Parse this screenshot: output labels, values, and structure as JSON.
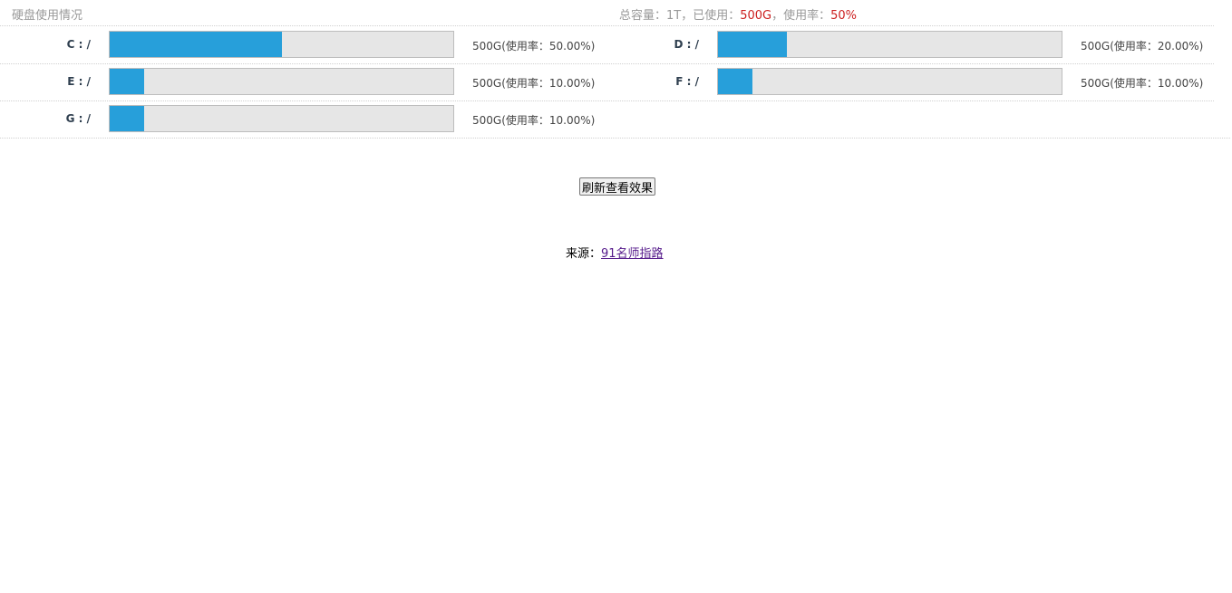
{
  "header": {
    "title": "硬盘使用情况",
    "summary_prefix": "总容量：1T，已使用：",
    "used": "500G",
    "summary_mid": "，使用率：",
    "rate": "50%"
  },
  "disks": [
    {
      "label": "C : /",
      "usage_fraction": 0.5,
      "info": "500G(使用率：50.00%)"
    },
    {
      "label": "D : /",
      "usage_fraction": 0.2,
      "info": "500G(使用率：20.00%)"
    },
    {
      "label": "E : /",
      "usage_fraction": 0.1,
      "info": "500G(使用率：10.00%)"
    },
    {
      "label": "F : /",
      "usage_fraction": 0.1,
      "info": "500G(使用率：10.00%)"
    },
    {
      "label": "G : /",
      "usage_fraction": 0.1,
      "info": "500G(使用率：10.00%)"
    }
  ],
  "refresh_button": "刷新查看效果",
  "source": {
    "prefix": "来源：",
    "link_text": "91名师指路"
  },
  "colors": {
    "bar_fill": "#279fda",
    "bar_track": "#e6e6e6",
    "highlight": "#cc1f1f"
  }
}
